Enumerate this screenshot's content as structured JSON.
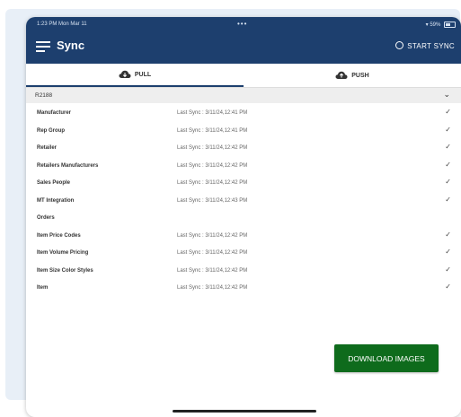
{
  "status_bar": {
    "time": "1:23 PM  Mon Mar 11",
    "dots": "•••",
    "battery": "59%"
  },
  "header": {
    "title": "Sync",
    "start_sync_label": "START SYNC"
  },
  "tabs": {
    "pull": "PULL",
    "push": "PUSH",
    "active": "PULL"
  },
  "group": {
    "label": "R2188"
  },
  "rows": [
    {
      "name": "Manufacturer",
      "sync": "Last Sync : 3/11/24,12:41 PM",
      "checked": true
    },
    {
      "name": "Rep Group",
      "sync": "Last Sync : 3/11/24,12:41 PM",
      "checked": true
    },
    {
      "name": "Retailer",
      "sync": "Last Sync : 3/11/24,12:42 PM",
      "checked": true
    },
    {
      "name": "Retailers Manufacturers",
      "sync": "Last Sync : 3/11/24,12:42 PM",
      "checked": true
    },
    {
      "name": "Sales People",
      "sync": "Last Sync : 3/11/24,12:42 PM",
      "checked": true
    },
    {
      "name": "MT Integration",
      "sync": "Last Sync : 3/11/24,12:43 PM",
      "checked": true
    },
    {
      "name": "Orders",
      "sync": "",
      "checked": false
    },
    {
      "name": "Item Price Codes",
      "sync": "Last Sync : 3/11/24,12:42 PM",
      "checked": true
    },
    {
      "name": "Item Volume Pricing",
      "sync": "Last Sync : 3/11/24,12:42 PM",
      "checked": true
    },
    {
      "name": "Item Size Color Styles",
      "sync": "Last Sync : 3/11/24,12:42 PM",
      "checked": true
    },
    {
      "name": "Item",
      "sync": "Last Sync : 3/11/24,12:42 PM",
      "checked": true
    }
  ],
  "download_button": "DOWNLOAD IMAGES",
  "colors": {
    "header": "#1d3f6e",
    "button": "#0e6b1c"
  }
}
